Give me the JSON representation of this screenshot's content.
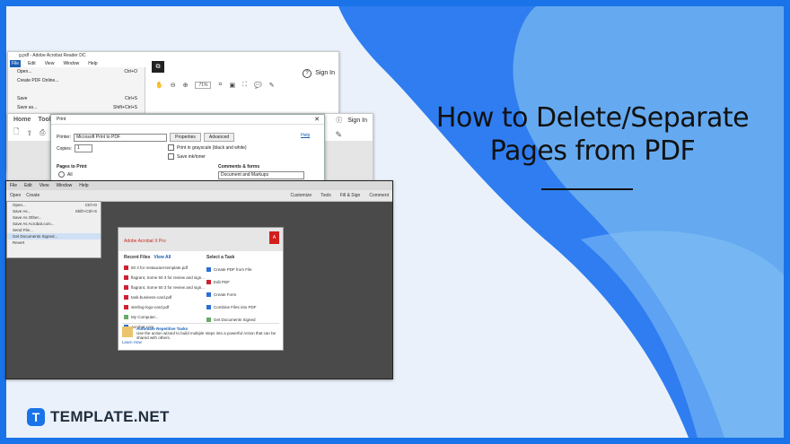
{
  "colors": {
    "accent": "#1a73e8",
    "blob_dark": "#2f7df0",
    "blob_light": "#6fb1f0"
  },
  "title_line1": "How to Delete/Separate",
  "title_line2": "Pages from PDF",
  "brand": {
    "icon_letter": "T",
    "name": "TEMPLATE.NET"
  },
  "win1": {
    "title": "g.pdf - Adobe Acrobat Reader DC",
    "menus": [
      "File",
      "Edit",
      "View",
      "Window",
      "Help"
    ],
    "file_menu": [
      {
        "label": "Open...",
        "shortcut": "Ctrl+O"
      },
      {
        "label": "Create PDF Online...",
        "shortcut": ""
      },
      {
        "label": "",
        "shortcut": ""
      },
      {
        "label": "Save",
        "shortcut": "Ctrl+S"
      },
      {
        "label": "Save as...",
        "shortcut": "Shift+Ctrl+S"
      }
    ],
    "zoom": "71%",
    "signin": "Sign In"
  },
  "win2": {
    "tabs": [
      "Home",
      "Tools"
    ],
    "signin": "Sign In"
  },
  "dialog": {
    "title": "Print",
    "printer_label": "Printer:",
    "printer_value": "Microsoft Print to PDF",
    "properties": "Properties",
    "advanced": "Advanced",
    "help": "Help",
    "copies_label": "Copies:",
    "copies_value": "1",
    "grayscale": "Print in grayscale (black and white)",
    "save_ink": "Save ink/toner",
    "pages_header": "Pages to Print",
    "all": "All",
    "comments_header": "Comments & forms",
    "comments_value": "Document and Markups"
  },
  "win3": {
    "menus": [
      "File",
      "Edit",
      "View",
      "Window",
      "Help"
    ],
    "tb_left": [
      "Open",
      "Create"
    ],
    "tb_right": [
      "Customize"
    ],
    "tabs_right": [
      "Tools",
      "Fill & Sign",
      "Comment"
    ],
    "file_menu": [
      {
        "label": "Open...",
        "shortcut": "Ctrl+O"
      },
      {
        "label": "Save As...",
        "shortcut": "Shift+Ctrl+S"
      },
      {
        "label": "Save As Other...",
        "shortcut": ""
      },
      {
        "label": "Save As Acrobat.com...",
        "shortcut": ""
      },
      {
        "label": "Send File...",
        "shortcut": ""
      },
      {
        "label": "Get Documents Signed...",
        "shortcut": ""
      },
      {
        "label": "Revert",
        "shortcut": ""
      }
    ],
    "welcome": {
      "product": "Adobe Acrobat X Pro",
      "adobe_letter": "A",
      "recent_header": "Recent Files",
      "view_all": "View All",
      "recent": [
        "50 3 for restaurant-template.pdf",
        "flagrant, Some 50 3 for review and sign...",
        "flagrant, Some 50 3 for review and sign...",
        "task-business-card.pdf",
        "sterling-logo-card.pdf",
        "My Computer...",
        "Acrobat.com"
      ],
      "task_header": "Select a Task",
      "tasks": [
        "Create PDF from File",
        "Edit PDF",
        "Create Form",
        "Combine Files into PDF",
        "Get Documents Signed"
      ],
      "footer_title": "Automate Repetitive Tasks",
      "footer_text": "Use the action wizard to build multiple steps into a powerful Action that can be shared with others.",
      "footer_link": "Learn How"
    }
  }
}
